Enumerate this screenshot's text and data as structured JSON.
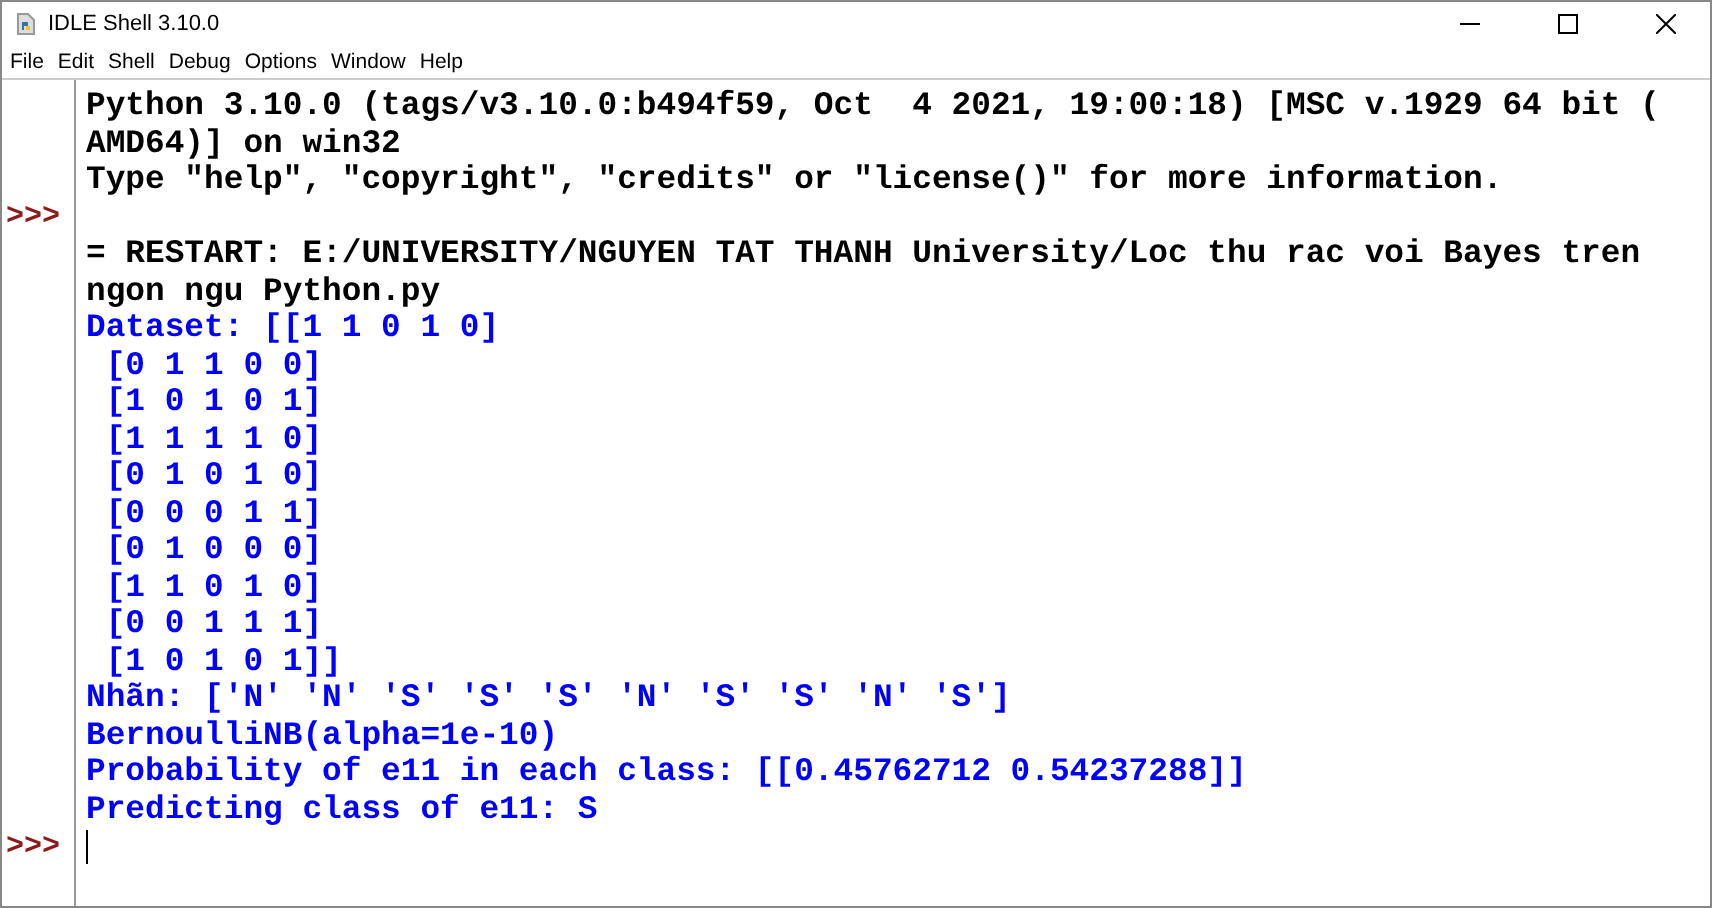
{
  "window": {
    "title": "IDLE Shell 3.10.0"
  },
  "menu": [
    "File",
    "Edit",
    "Shell",
    "Debug",
    "Options",
    "Window",
    "Help"
  ],
  "lines": [
    {
      "kind": "output",
      "text": "Python 3.10.0 (tags/v3.10.0:b494f59, Oct  4 2021, 19:00:18) [MSC v.1929 64 bit ("
    },
    {
      "kind": "output",
      "text": "AMD64)] on win32"
    },
    {
      "kind": "output",
      "text": "Type \"help\", \"copyright\", \"credits\" or \"license()\" for more information."
    },
    {
      "prompt": ">>>"
    },
    {
      "kind": "output",
      "text": "= RESTART: E:/UNIVERSITY/NGUYEN TAT THANH University/Loc thu rac voi Bayes tren"
    },
    {
      "kind": "output",
      "text": "ngon ngu Python.py"
    },
    {
      "kind": "stdout",
      "text": "Dataset: [[1 1 0 1 0]"
    },
    {
      "kind": "stdout",
      "text": " [0 1 1 0 0]"
    },
    {
      "kind": "stdout",
      "text": " [1 0 1 0 1]"
    },
    {
      "kind": "stdout",
      "text": " [1 1 1 1 0]"
    },
    {
      "kind": "stdout",
      "text": " [0 1 0 1 0]"
    },
    {
      "kind": "stdout",
      "text": " [0 0 0 1 1]"
    },
    {
      "kind": "stdout",
      "text": " [0 1 0 0 0]"
    },
    {
      "kind": "stdout",
      "text": " [1 1 0 1 0]"
    },
    {
      "kind": "stdout",
      "text": " [0 0 1 1 1]"
    },
    {
      "kind": "stdout",
      "text": " [1 0 1 0 1]]"
    },
    {
      "kind": "stdout",
      "text": "Nhãn: ['N' 'N' 'S' 'S' 'S' 'N' 'S' 'S' 'N' 'S']"
    },
    {
      "kind": "stdout",
      "text": "BernoulliNB(alpha=1e-10)"
    },
    {
      "kind": "stdout",
      "text": "Probability of e11 in each class: [[0.45762712 0.54237288]]"
    },
    {
      "kind": "stdout",
      "text": "Predicting class of e11: S"
    },
    {
      "prompt": ">>>"
    }
  ]
}
